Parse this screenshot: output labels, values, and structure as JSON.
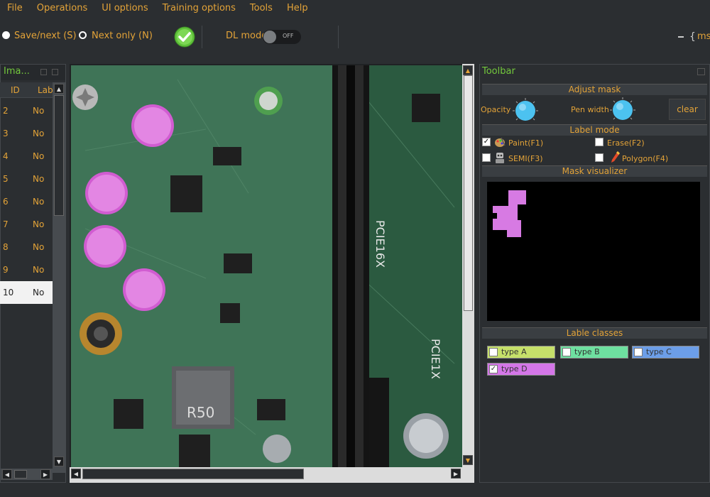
{
  "menu": [
    "File",
    "Operations",
    "UI options",
    "Training options",
    "Tools",
    "Help"
  ],
  "toolbar": {
    "save_next": "Save/next (S)",
    "next_only": "Next only (N)",
    "dl_mode_label": "DL mode",
    "dl_toggle": "OFF",
    "ms_text": "ms"
  },
  "images_panel": {
    "title": "Ima...",
    "columns": [
      "ID",
      "Lab"
    ],
    "rows": [
      {
        "id": "2",
        "label": "No"
      },
      {
        "id": "3",
        "label": "No"
      },
      {
        "id": "4",
        "label": "No"
      },
      {
        "id": "5",
        "label": "No"
      },
      {
        "id": "6",
        "label": "No"
      },
      {
        "id": "7",
        "label": "No"
      },
      {
        "id": "8",
        "label": "No"
      },
      {
        "id": "9",
        "label": "No"
      },
      {
        "id": "10",
        "label": "No"
      }
    ],
    "selected_id": "10"
  },
  "image_text": {
    "pcie16": "PCIE16X",
    "pcie1": "PCIE1X",
    "r50": "R50"
  },
  "right": {
    "title": "Toolbar",
    "adjust_mask": "Adjust mask",
    "opacity": "Opacity",
    "pen_width": "Pen width",
    "clear": "clear",
    "label_mode": "Label mode",
    "paint": "Paint(F1)",
    "erase": "Erase(F2)",
    "semi": "SEMI(F3)",
    "polygon": "Polygon(F4)",
    "mask_visualizer": "Mask visualizer",
    "lable_classes": "Lable classes",
    "classes": [
      {
        "name": "type A",
        "color": "#c6e06a",
        "checked": false
      },
      {
        "name": "type B",
        "color": "#6ee0a0",
        "checked": false
      },
      {
        "name": "type C",
        "color": "#6c9ee8",
        "checked": false
      },
      {
        "name": "type D",
        "color": "#d476e8",
        "checked": true
      }
    ]
  },
  "colors": {
    "accent_text": "#e3a338",
    "panel_title": "#73c83c",
    "mask": "#d77ae3",
    "knob": "#4cc2f0"
  }
}
